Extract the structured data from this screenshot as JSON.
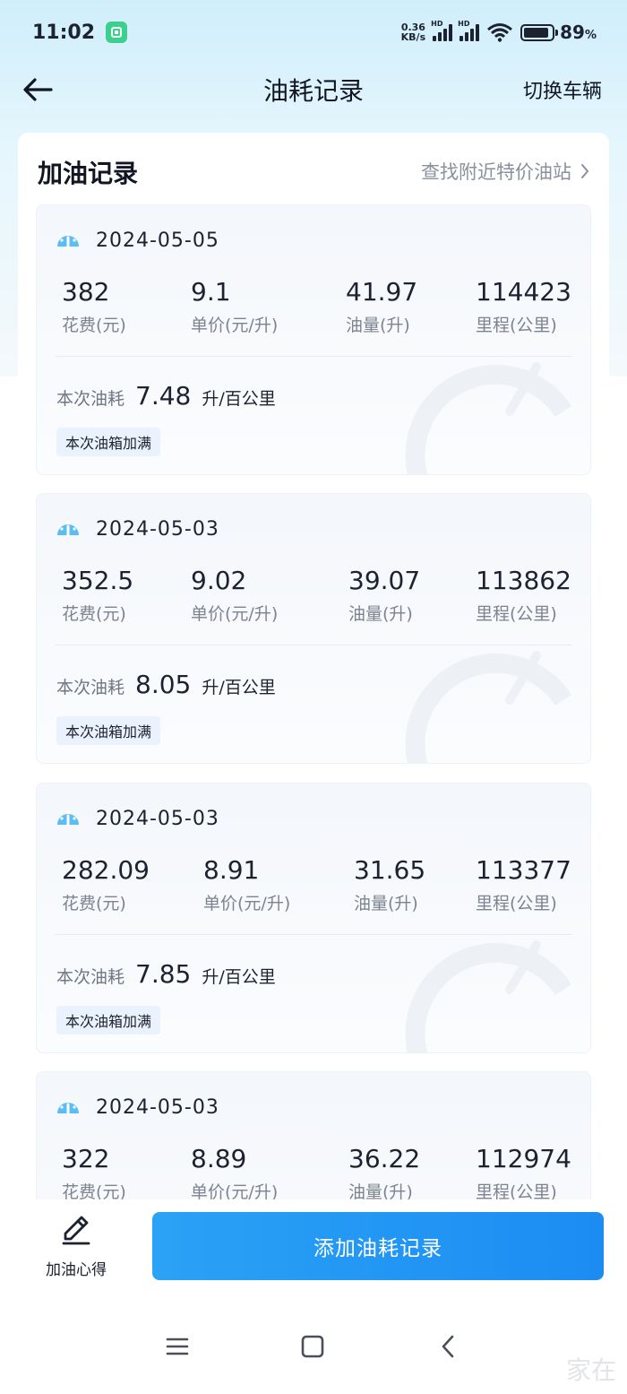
{
  "status_bar": {
    "time": "11:02",
    "net_speed_value": "0.36",
    "net_speed_unit": "KB/s",
    "signal_label": "HD",
    "battery_percent": "89",
    "battery_percent_sign": "%",
    "battery_level": 0.89
  },
  "nav": {
    "title": "油耗记录",
    "switch_vehicle": "切换车辆",
    "back_icon": "back-arrow-icon"
  },
  "panel": {
    "title": "加油记录",
    "nearby_link": "查找附近特价油站",
    "labels": {
      "cost": "花费(元)",
      "unit_price": "单价(元/升)",
      "volume": "油量(升)",
      "mileage": "里程(公里)",
      "consumption": "本次油耗",
      "consumption_unit": "升/百公里",
      "full_tank": "本次油箱加满"
    },
    "records": [
      {
        "date": "2024-05-05",
        "cost": "382",
        "unit_price": "9.1",
        "volume": "41.97",
        "mileage": "114423",
        "consumption": "7.48"
      },
      {
        "date": "2024-05-03",
        "cost": "352.5",
        "unit_price": "9.02",
        "volume": "39.07",
        "mileage": "113862",
        "consumption": "8.05"
      },
      {
        "date": "2024-05-03",
        "cost": "282.09",
        "unit_price": "8.91",
        "volume": "31.65",
        "mileage": "113377",
        "consumption": "7.85"
      },
      {
        "date": "2024-05-03",
        "cost": "322",
        "unit_price": "8.89",
        "volume": "36.22",
        "mileage": "112974",
        "consumption": ""
      }
    ]
  },
  "bottom": {
    "tips_label": "加油心得",
    "add_button": "添加油耗记录"
  },
  "watermark": "家在",
  "colors": {
    "accent": "#1c8cf3",
    "badge_bg": "#e9f2fd",
    "header_bg": "#cfeefb"
  }
}
